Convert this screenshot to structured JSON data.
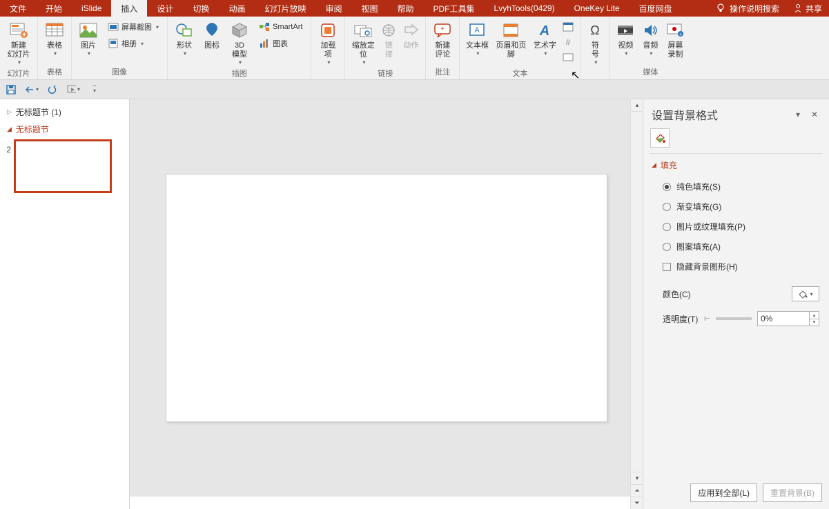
{
  "tabs": {
    "file": "文件",
    "home": "开始",
    "islide": "iSlide",
    "insert": "插入",
    "design": "设计",
    "transitions": "切换",
    "animations": "动画",
    "slideshow": "幻灯片放映",
    "review": "审阅",
    "view": "视图",
    "help": "帮助",
    "pdf": "PDF工具集",
    "lvyh": "LvyhTools(0429)",
    "onekey": "OneKey Lite",
    "baidu": "百度网盘"
  },
  "help_search": "操作说明搜索",
  "share": "共享",
  "ribbon": {
    "new_slide": "新建\n幻灯片",
    "slides_grp": "幻灯片",
    "table": "表格",
    "tables_grp": "表格",
    "picture": "图片",
    "screenshot": "屏幕截图",
    "album": "相册",
    "images_grp": "图像",
    "shape": "形状",
    "icon": "图标",
    "model3d": "3D\n模型",
    "smartart": "SmartArt",
    "chart": "图表",
    "illust_grp": "插图",
    "addin": "加载\n项",
    "zoom": "缩放定\n位",
    "link": "链\n接",
    "action": "动作",
    "links_grp": "链接",
    "comment": "新建\n评论",
    "comments_grp": "批注",
    "textbox": "文本框",
    "headerfooter": "页眉和页脚",
    "wordart": "艺术字",
    "text_grp": "文本",
    "symbol": "符\n号",
    "video": "视频",
    "audio": "音频",
    "screenrec": "屏幕\n录制",
    "media_grp": "媒体"
  },
  "sections": {
    "untitled1": "无标题节  (1)",
    "untitled2": "无标题节",
    "slide_num": "2"
  },
  "right_pane": {
    "title": "设置背景格式",
    "section_fill": "填充",
    "solid": "纯色填充(S)",
    "gradient": "渐变填充(G)",
    "picture": "图片或纹理填充(P)",
    "pattern": "图案填充(A)",
    "hide": "隐藏背景图形(H)",
    "color": "颜色(C)",
    "transparency": "透明度(T)",
    "trans_value": "0%",
    "apply_all": "应用到全部(L)",
    "reset": "重置背景(B)"
  }
}
